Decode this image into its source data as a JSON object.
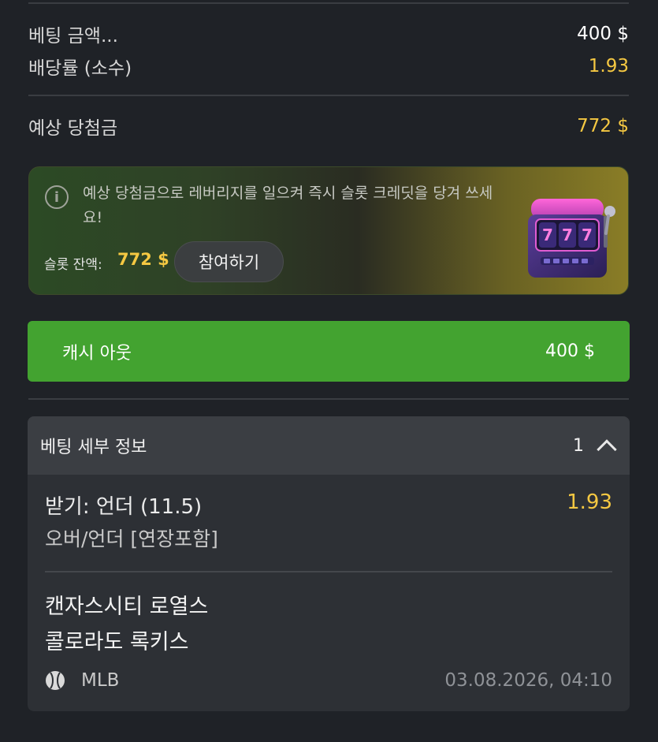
{
  "summary": {
    "stake_label": "베팅 금액...",
    "stake_value": "400 $",
    "odds_label": "배당률 (소수)",
    "odds_value": "1.93",
    "payout_label": "예상 당첨금",
    "payout_value": "772 $"
  },
  "promo": {
    "text": "예상 당첨금으로 레버리지를 일으켜 즉시 슬롯 크레딧을 당겨 쓰세요!",
    "balance_label": "슬롯 잔액:",
    "balance_value": "772 $",
    "join_label": "참여하기",
    "slot_reels": [
      "7",
      "7",
      "7"
    ]
  },
  "cashout": {
    "label": "캐시 아웃",
    "value": "400 $"
  },
  "bet_details": {
    "title": "베팅 세부 정보",
    "count": "1",
    "pick": "받기: 언더 (11.5)",
    "pick_odds": "1.93",
    "market": "오버/언더 [연장포함]",
    "team_home": "캔자스시티 로열스",
    "team_away": "콜로라도 록키스",
    "league": "MLB",
    "datetime": "03.08.2026, 04:10"
  },
  "colors": {
    "background": "#1f2227",
    "gold": "#f5c842",
    "cashout_green": "#43a330",
    "details_header": "#3b3e43",
    "details_body": "#2d3035"
  },
  "icons": {
    "info": "info-circle-icon",
    "slot": "slot-machine-icon",
    "sport": "baseball-icon",
    "collapse": "chevron-up-icon"
  }
}
